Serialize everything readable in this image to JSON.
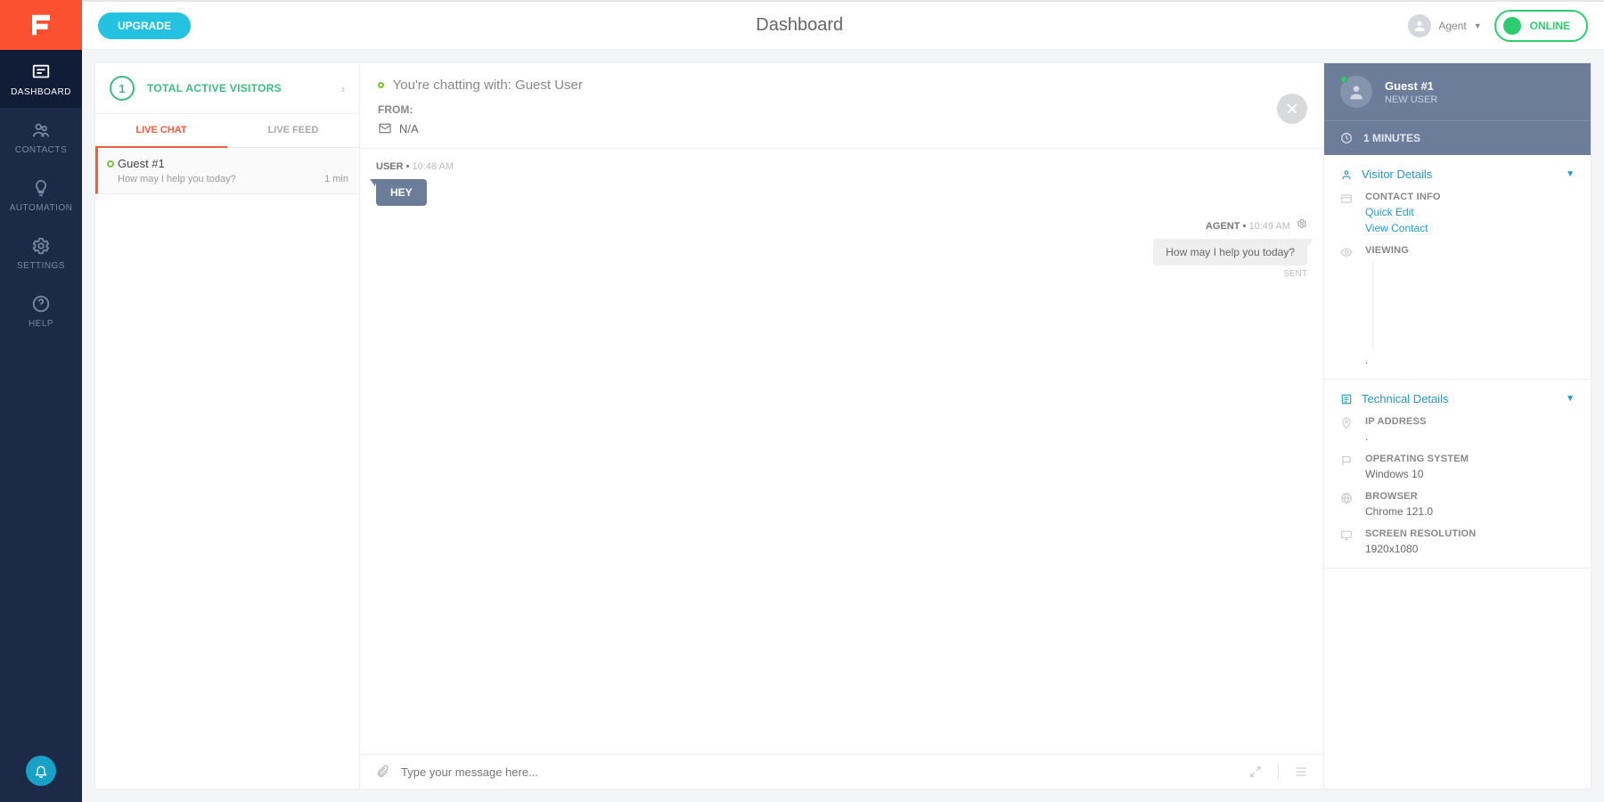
{
  "topbar": {
    "upgrade_label": "UPGRADE",
    "title": "Dashboard",
    "agent_name": "Agent",
    "status_label": "ONLINE"
  },
  "nav": {
    "items": [
      {
        "id": "dashboard",
        "label": "DASHBOARD",
        "active": true
      },
      {
        "id": "contacts",
        "label": "CONTACTS",
        "active": false
      },
      {
        "id": "automation",
        "label": "AUTOMATION",
        "active": false
      },
      {
        "id": "settings",
        "label": "SETTINGS",
        "active": false
      },
      {
        "id": "help",
        "label": "HELP",
        "active": false
      }
    ]
  },
  "left": {
    "visitor_count": "1",
    "visitor_label": "TOTAL ACTIVE VISITORS",
    "tabs": [
      {
        "id": "live-chat",
        "label": "LIVE CHAT",
        "active": true
      },
      {
        "id": "live-feed",
        "label": "LIVE FEED",
        "active": false
      }
    ],
    "chat": {
      "name": "Guest #1",
      "preview": "How may I help you today?",
      "elapsed": "1 min"
    }
  },
  "center": {
    "chatting_with": "You're chatting with: Guest User",
    "from_label": "FROM:",
    "from_value": "N/A",
    "messages": {
      "user_meta_prefix": "USER •",
      "user_time": "10:48 AM",
      "user_text": "HEY",
      "agent_meta_prefix": "AGENT •",
      "agent_time": "10:49 AM",
      "agent_text": "How may I help you today?",
      "sent_label": "SENT"
    },
    "composer_placeholder": "Type your message here..."
  },
  "right": {
    "guest_name": "Guest #1",
    "new_user_badge": "NEW USER",
    "duration": "1 MINUTES",
    "visitor_details_title": "Visitor Details",
    "contact_info_label": "CONTACT INFO",
    "quick_edit": "Quick Edit",
    "view_contact": "View Contact",
    "viewing_label": "VIEWING",
    "dotval": ".",
    "technical_details_title": "Technical Details",
    "ip_label": "IP ADDRESS",
    "ip_value": ".",
    "os_label": "OPERATING SYSTEM",
    "os_value": "Windows 10",
    "browser_label": "BROWSER",
    "browser_value": "Chrome 121.0",
    "res_label": "SCREEN RESOLUTION",
    "res_value": "1920x1080"
  }
}
